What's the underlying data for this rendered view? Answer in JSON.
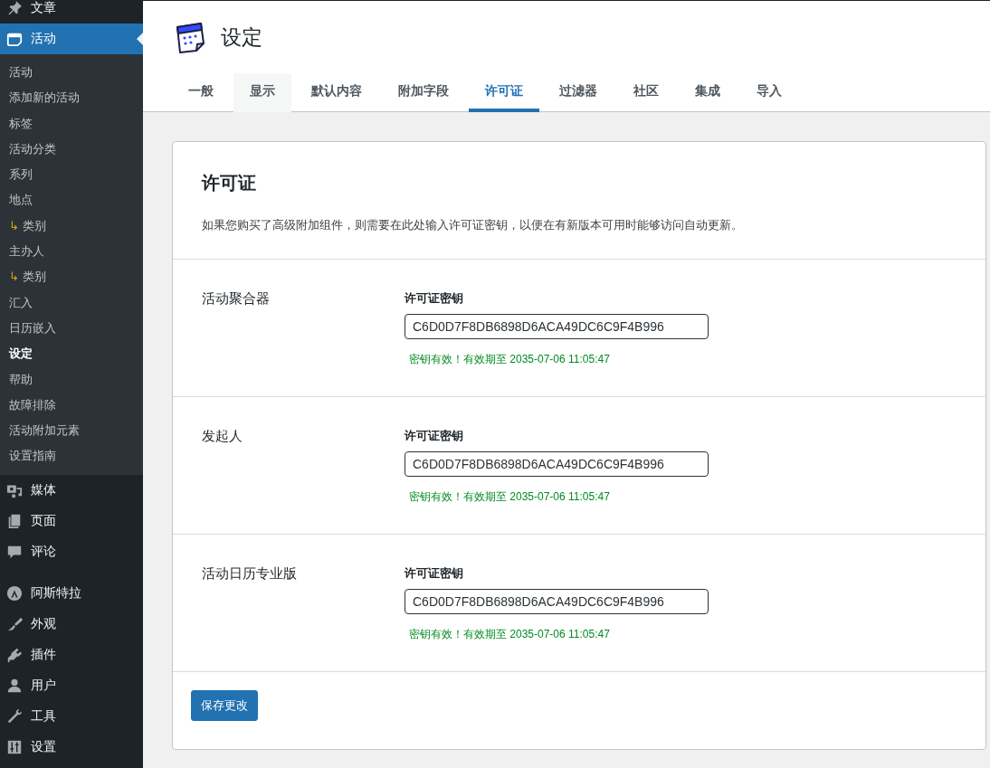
{
  "sidebar": {
    "items": [
      {
        "label": "文章",
        "selected": false
      },
      {
        "label": "活动",
        "selected": true,
        "children": [
          {
            "label": "活动",
            "selected": false
          },
          {
            "label": "添加新的活动",
            "selected": false
          },
          {
            "label": "标签",
            "selected": false
          },
          {
            "label": "活动分类",
            "selected": false
          },
          {
            "label": "系列",
            "selected": false
          },
          {
            "label": "地点",
            "selected": false
          },
          {
            "label": "类别",
            "marker": "↳",
            "selected": false
          },
          {
            "label": "主办人",
            "selected": false
          },
          {
            "label": "类别",
            "marker": "↳",
            "selected": false
          },
          {
            "label": "汇入",
            "selected": false
          },
          {
            "label": "日历嵌入",
            "selected": false
          },
          {
            "label": "设定",
            "selected": true
          },
          {
            "label": "帮助",
            "selected": false
          },
          {
            "label": "故障排除",
            "selected": false
          },
          {
            "label": "活动附加元素",
            "selected": false
          },
          {
            "label": "设置指南",
            "selected": false
          }
        ]
      },
      {
        "label": "媒体",
        "selected": false
      },
      {
        "label": "页面",
        "selected": false
      },
      {
        "label": "评论",
        "selected": false,
        "separator_after": true
      },
      {
        "label": "阿斯特拉",
        "selected": false
      },
      {
        "label": "外观",
        "selected": false
      },
      {
        "label": "插件",
        "selected": false
      },
      {
        "label": "用户",
        "selected": false
      },
      {
        "label": "工具",
        "selected": false
      },
      {
        "label": "设置",
        "selected": false
      }
    ]
  },
  "page": {
    "title": "设定"
  },
  "tabs": [
    {
      "label": "一般",
      "selected": false,
      "hovered": false
    },
    {
      "label": "显示",
      "selected": false,
      "hovered": true
    },
    {
      "label": "默认内容",
      "selected": false,
      "hovered": false
    },
    {
      "label": "附加字段",
      "selected": false,
      "hovered": false
    },
    {
      "label": "许可证",
      "selected": true,
      "hovered": false
    },
    {
      "label": "过滤器",
      "selected": false,
      "hovered": false
    },
    {
      "label": "社区",
      "selected": false,
      "hovered": false
    },
    {
      "label": "集成",
      "selected": false,
      "hovered": false
    },
    {
      "label": "导入",
      "selected": false,
      "hovered": false
    }
  ],
  "panel": {
    "heading": "许可证",
    "description": "如果您购买了高级附加组件，则需要在此处输入许可证密钥，以便在有新版本可用时能够访问自动更新。",
    "licenses": [
      {
        "name": "活动聚合器",
        "field_label": "许可证密钥",
        "value": "C6D0D7F8DB6898D6ACA49DC6C9F4B996",
        "status": "密钥有效！有效期至 2035-07-06 11:05:47",
        "valid": true
      },
      {
        "name": "发起人",
        "field_label": "许可证密钥",
        "value": "C6D0D7F8DB6898D6ACA49DC6C9F4B996",
        "status": "密钥有效！有效期至 2035-07-06 11:05:47",
        "valid": true
      },
      {
        "name": "活动日历专业版",
        "field_label": "许可证密钥",
        "value": "C6D0D7F8DB6898D6ACA49DC6C9F4B996",
        "status": "密钥有效！有效期至 2035-07-06 11:05:47",
        "valid": true
      }
    ],
    "save_button": "保存更改"
  }
}
